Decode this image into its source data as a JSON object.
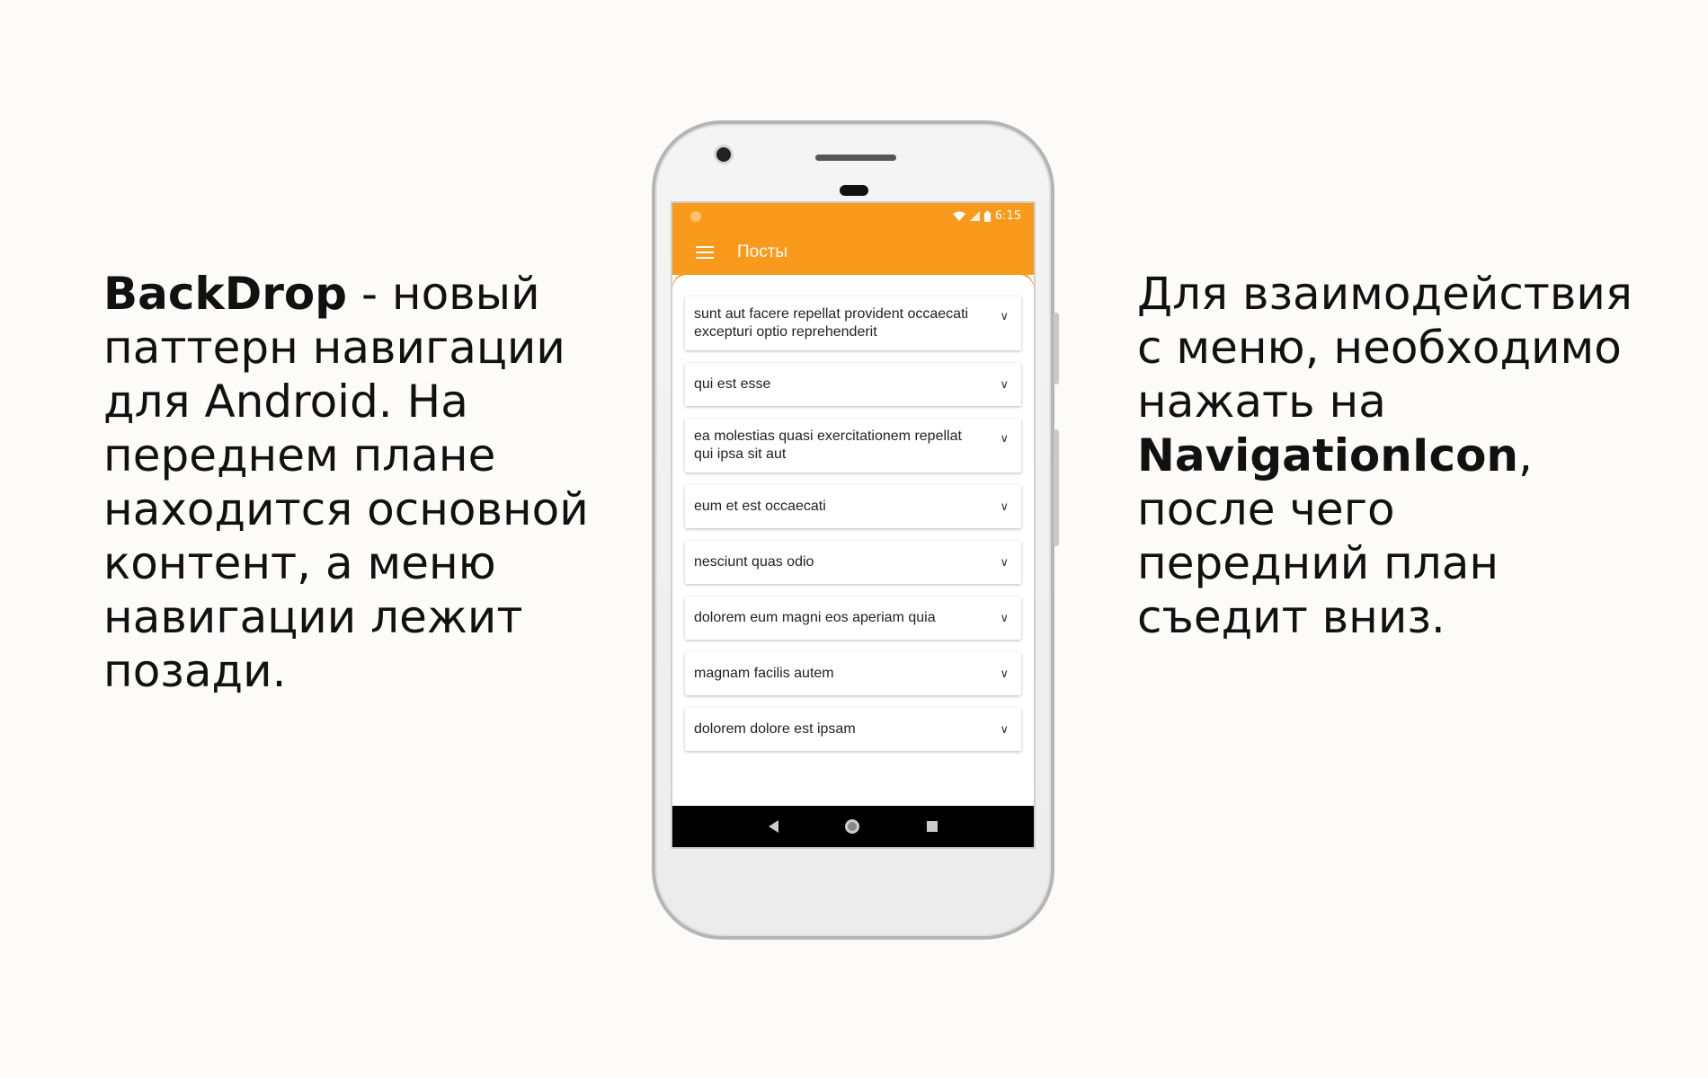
{
  "left_text": {
    "bold": "BackDrop",
    "rest": " -  новый паттерн навигации для Android. На переднем плане находится основной контент, а меню навигации лежит позади."
  },
  "right_text": {
    "before": "Для взаимодействия с меню, необходимо нажать на ",
    "bold": "NavigationIcon",
    "after": ", после чего передний план съедит вниз."
  },
  "status_bar": {
    "time": "6:15"
  },
  "toolbar": {
    "title": "Посты",
    "menu_icon": "hamburger-menu-icon"
  },
  "posts": [
    {
      "title": "sunt aut facere repellat provident occaecati excepturi optio reprehenderit"
    },
    {
      "title": "qui est esse"
    },
    {
      "title": "ea molestias quasi exercitationem repellat qui ipsa sit aut"
    },
    {
      "title": "eum et est occaecati"
    },
    {
      "title": "nesciunt quas odio"
    },
    {
      "title": "dolorem eum magni eos aperiam quia"
    },
    {
      "title": "magnam facilis autem"
    },
    {
      "title": "dolorem dolore est ipsam"
    }
  ],
  "colors": {
    "accent": "#f99a1c",
    "background": "#fcfbfa"
  }
}
